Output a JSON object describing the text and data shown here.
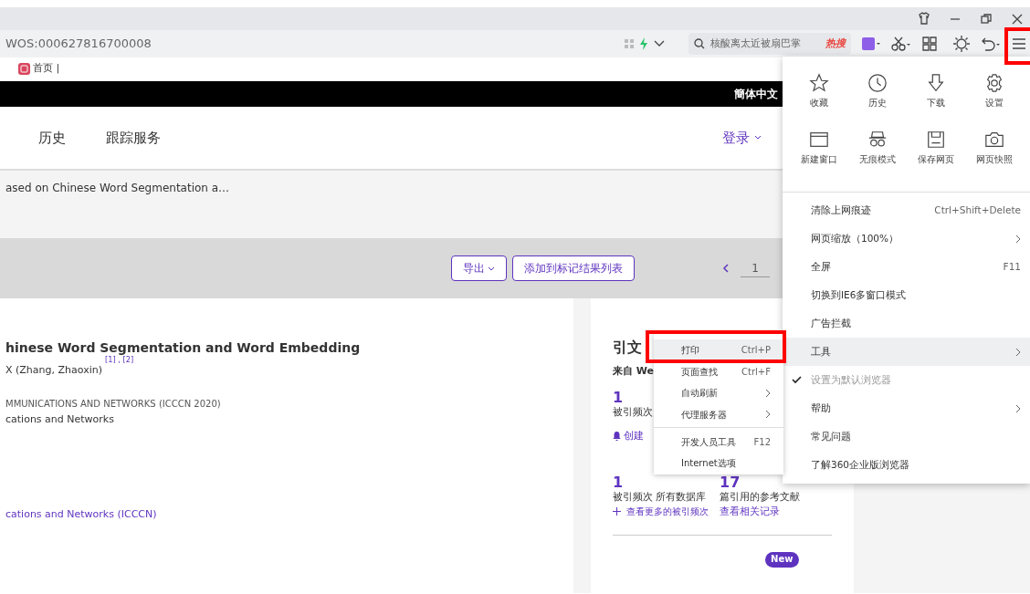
{
  "window": {
    "controls": [
      {
        "kind": "skin"
      },
      {
        "kind": "minimize"
      },
      {
        "kind": "restore"
      },
      {
        "kind": "close"
      }
    ]
  },
  "address_bar": {
    "url": "WOS:000627816700008",
    "search_placeholder": "核酸离太近被扇巴掌",
    "hot_label": "热搜",
    "menu_button_annotated": true
  },
  "bookmarks": [
    {
      "label": "首页 |"
    }
  ],
  "page": {
    "language": "簡体中文",
    "nav": [
      "历史",
      "跟踪服务"
    ],
    "login": "登录",
    "breadcrumb": "ased on Chinese Word Segmentation a…",
    "toolbar": {
      "export": "导出",
      "add_to_marked": "添加到标记结果列表",
      "page": "1"
    },
    "record": {
      "title": "hinese Word Segmentation and Word Embedding",
      "author": "X (Zhang, Zhaoxin)",
      "affiliations": "[1] , [2]",
      "conference": "MMUNICATIONS AND NETWORKS (ICCCN 2020)",
      "series": "cations and Networks",
      "link": "cations and Networks (ICCCN)"
    },
    "citation": {
      "heading": "引文",
      "source": "来自 We",
      "count": "1",
      "count_label": "被引频次",
      "alert": "创建",
      "stats": [
        {
          "value": "1",
          "label": "被引频次 所有数据库",
          "link": "查看更多的被引频次",
          "plus": true
        },
        {
          "value": "17",
          "label": "篇引用的参考文献",
          "link": "查看相关记录",
          "plus": false
        }
      ],
      "badge": "New"
    }
  },
  "menu": {
    "tiles": [
      {
        "label": "收藏",
        "kind": "star"
      },
      {
        "label": "历史",
        "kind": "clock"
      },
      {
        "label": "下载",
        "kind": "download"
      },
      {
        "label": "设置",
        "kind": "gear"
      },
      {
        "label": "新建窗口",
        "kind": "window"
      },
      {
        "label": "无痕模式",
        "kind": "incognito"
      },
      {
        "label": "保存网页",
        "kind": "save"
      },
      {
        "label": "网页快照",
        "kind": "camera"
      }
    ],
    "items": [
      {
        "label": "清除上网痕迹",
        "shortcut": "Ctrl+Shift+Delete",
        "submenu": false,
        "checked": false,
        "disabled": false,
        "selected": false
      },
      {
        "label": "网页缩放（100%）",
        "submenu": true,
        "checked": false,
        "disabled": false,
        "selected": false
      },
      {
        "label": "全屏",
        "shortcut": "F11",
        "submenu": false,
        "checked": false,
        "disabled": false,
        "selected": false
      },
      {
        "label": "切换到IE6多窗口模式",
        "submenu": false,
        "checked": false,
        "disabled": false,
        "selected": false
      },
      {
        "label": "广告拦截",
        "submenu": false,
        "checked": false,
        "disabled": false,
        "selected": false
      },
      {
        "label": "工具",
        "submenu": true,
        "checked": false,
        "disabled": false,
        "selected": true
      },
      {
        "label": "设置为默认浏览器",
        "submenu": false,
        "checked": true,
        "disabled": true,
        "selected": false
      },
      {
        "label": "帮助",
        "submenu": true,
        "checked": false,
        "disabled": false,
        "selected": false
      },
      {
        "label": "常见问题",
        "submenu": false,
        "checked": false,
        "disabled": false,
        "selected": false
      },
      {
        "label": "了解360企业版浏览器",
        "submenu": false,
        "checked": false,
        "disabled": false,
        "selected": false
      }
    ]
  },
  "submenu": {
    "items": [
      {
        "label": "打印",
        "shortcut": "Ctrl+P",
        "submenu": false,
        "selected": true,
        "annotated": true,
        "separator_before": false
      },
      {
        "label": "页面查找",
        "shortcut": "Ctrl+F",
        "submenu": false,
        "selected": false,
        "annotated": false,
        "separator_before": false
      },
      {
        "label": "自动刷新",
        "submenu": true,
        "selected": false,
        "annotated": false,
        "separator_before": false
      },
      {
        "label": "代理服务器",
        "submenu": true,
        "selected": false,
        "annotated": false,
        "separator_before": false
      },
      {
        "label": "开发人员工具",
        "shortcut": "F12",
        "submenu": false,
        "selected": false,
        "annotated": false,
        "separator_before": true
      },
      {
        "label": "Internet选项",
        "submenu": false,
        "selected": false,
        "annotated": false,
        "separator_before": false
      }
    ]
  }
}
